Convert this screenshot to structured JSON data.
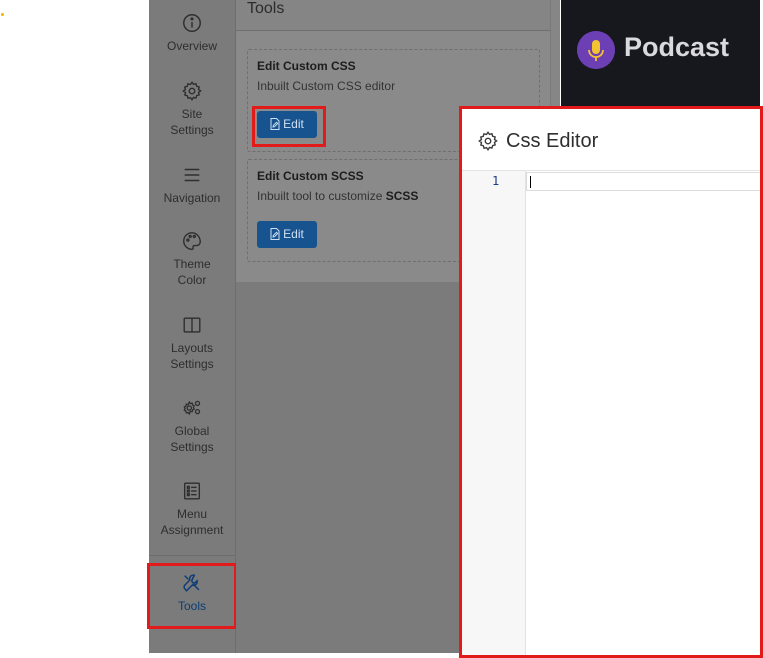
{
  "sidebar": {
    "items": [
      {
        "label": "Overview",
        "icon": "info-icon"
      },
      {
        "label": "Site Settings",
        "icon": "gear-icon"
      },
      {
        "label": "Navigation",
        "icon": "menu-lines-icon"
      },
      {
        "label": "Theme Color",
        "icon": "palette-icon"
      },
      {
        "label": "Layouts Settings",
        "icon": "columns-icon"
      },
      {
        "label": "Global Settings",
        "icon": "gears-icon"
      },
      {
        "label": "Menu Assignment",
        "icon": "list-icon"
      },
      {
        "label": "Tools",
        "icon": "tools-icon",
        "active": true
      }
    ]
  },
  "panel": {
    "title": "Tools",
    "cards": [
      {
        "title": "Edit Custom CSS",
        "desc": "Inbuilt Custom CSS editor",
        "desc_bold": "",
        "button": "Edit"
      },
      {
        "title": "Edit Custom SCSS",
        "desc": "Inbuilt tool to customize ",
        "desc_bold": "SCSS",
        "button": "Edit"
      }
    ]
  },
  "header": {
    "brand": "Podcast",
    "logo_icon": "microphone-icon"
  },
  "editor": {
    "title": "Css Editor",
    "icon": "gear-icon",
    "line_numbers": [
      "1"
    ],
    "code": ""
  },
  "colors": {
    "accent": "#17538f",
    "highlight": "#e21a1a",
    "brand_purple": "#6d3fb5"
  }
}
